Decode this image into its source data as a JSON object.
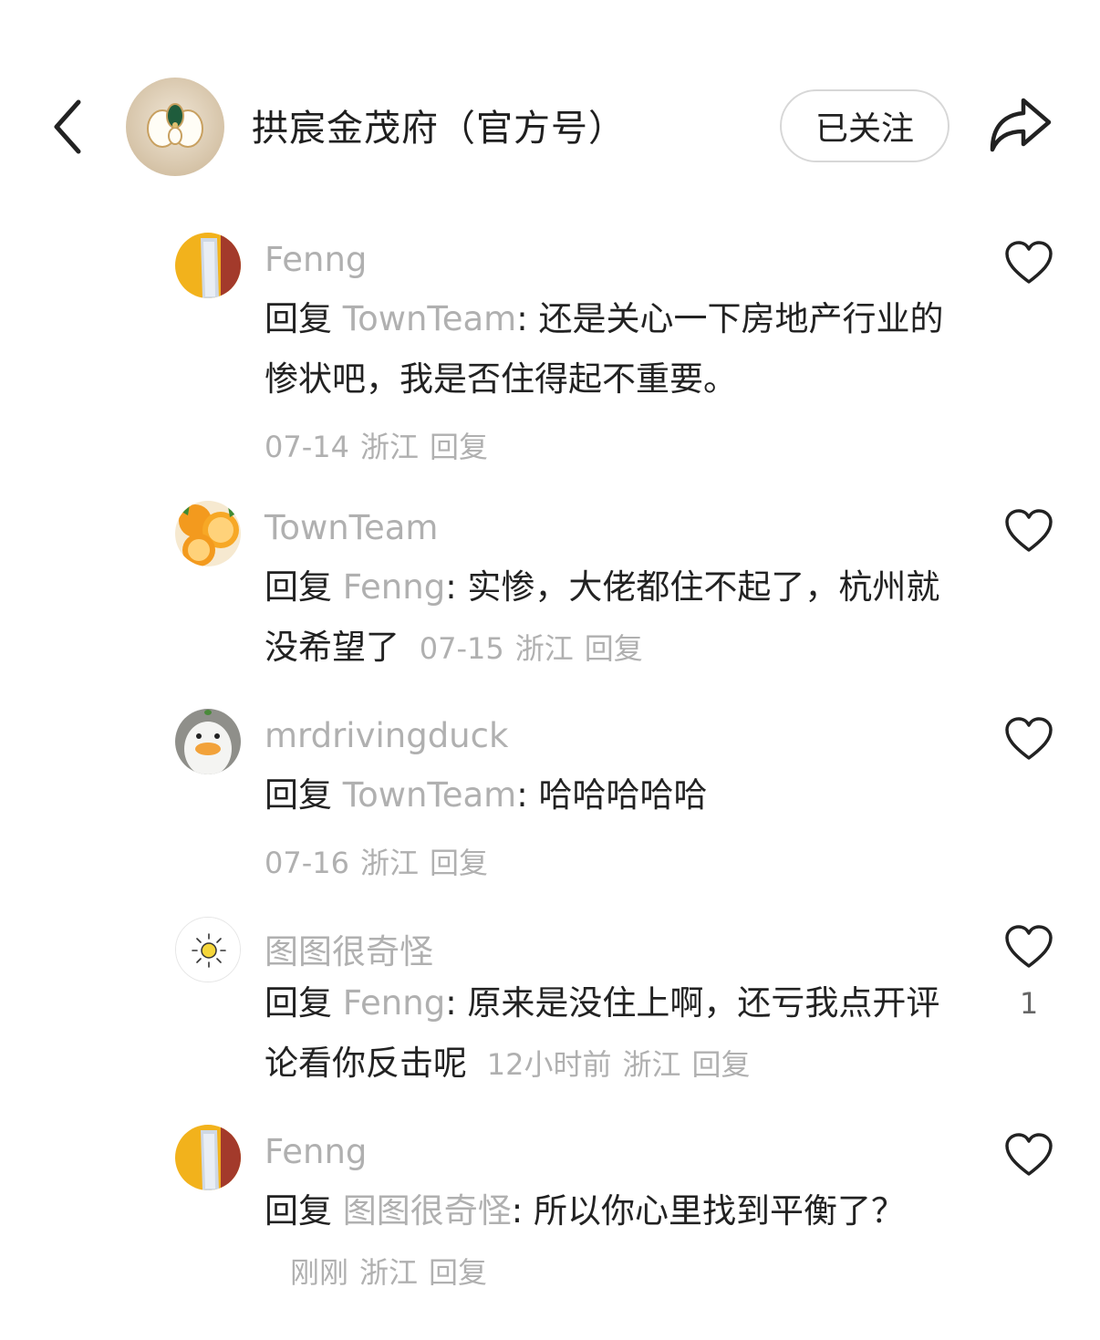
{
  "header": {
    "title": "拱宸金茂府（官方号）",
    "follow_label": "已关注"
  },
  "comments": [
    {
      "username": "Fenng",
      "reply_word": "回复",
      "reply_target": "TownTeam",
      "text": ": 还是关心一下房地产行业的惨状吧，我是否住得起不重要。",
      "date": "07-14",
      "location": "浙江",
      "reply_label": "回复",
      "likes": ""
    },
    {
      "username": "TownTeam",
      "reply_word": "回复",
      "reply_target": "Fenng",
      "text": ": 实惨，大佬都住不起了，杭州就没希望了",
      "date": "07-15",
      "location": "浙江",
      "reply_label": "回复",
      "likes": ""
    },
    {
      "username": "mrdrivingduck",
      "reply_word": "回复",
      "reply_target": "TownTeam",
      "text": ": 哈哈哈哈哈",
      "date": "07-16",
      "location": "浙江",
      "reply_label": "回复",
      "likes": ""
    },
    {
      "username": "图图很奇怪",
      "reply_word": "回复",
      "reply_target": "Fenng",
      "text": ": 原来是没住上啊，还亏我点开评论看你反击呢",
      "date": "12小时前",
      "location": "浙江",
      "reply_label": "回复",
      "likes": "1"
    },
    {
      "username": "Fenng",
      "reply_word": "回复",
      "reply_target": "图图很奇怪",
      "text": ": 所以你心里找到平衡了？",
      "date": "刚刚",
      "location": "浙江",
      "reply_label": "回复",
      "likes": ""
    }
  ],
  "colors": {
    "muted": "#b0b0b0",
    "text": "#222222",
    "border": "#d7d7d7"
  }
}
